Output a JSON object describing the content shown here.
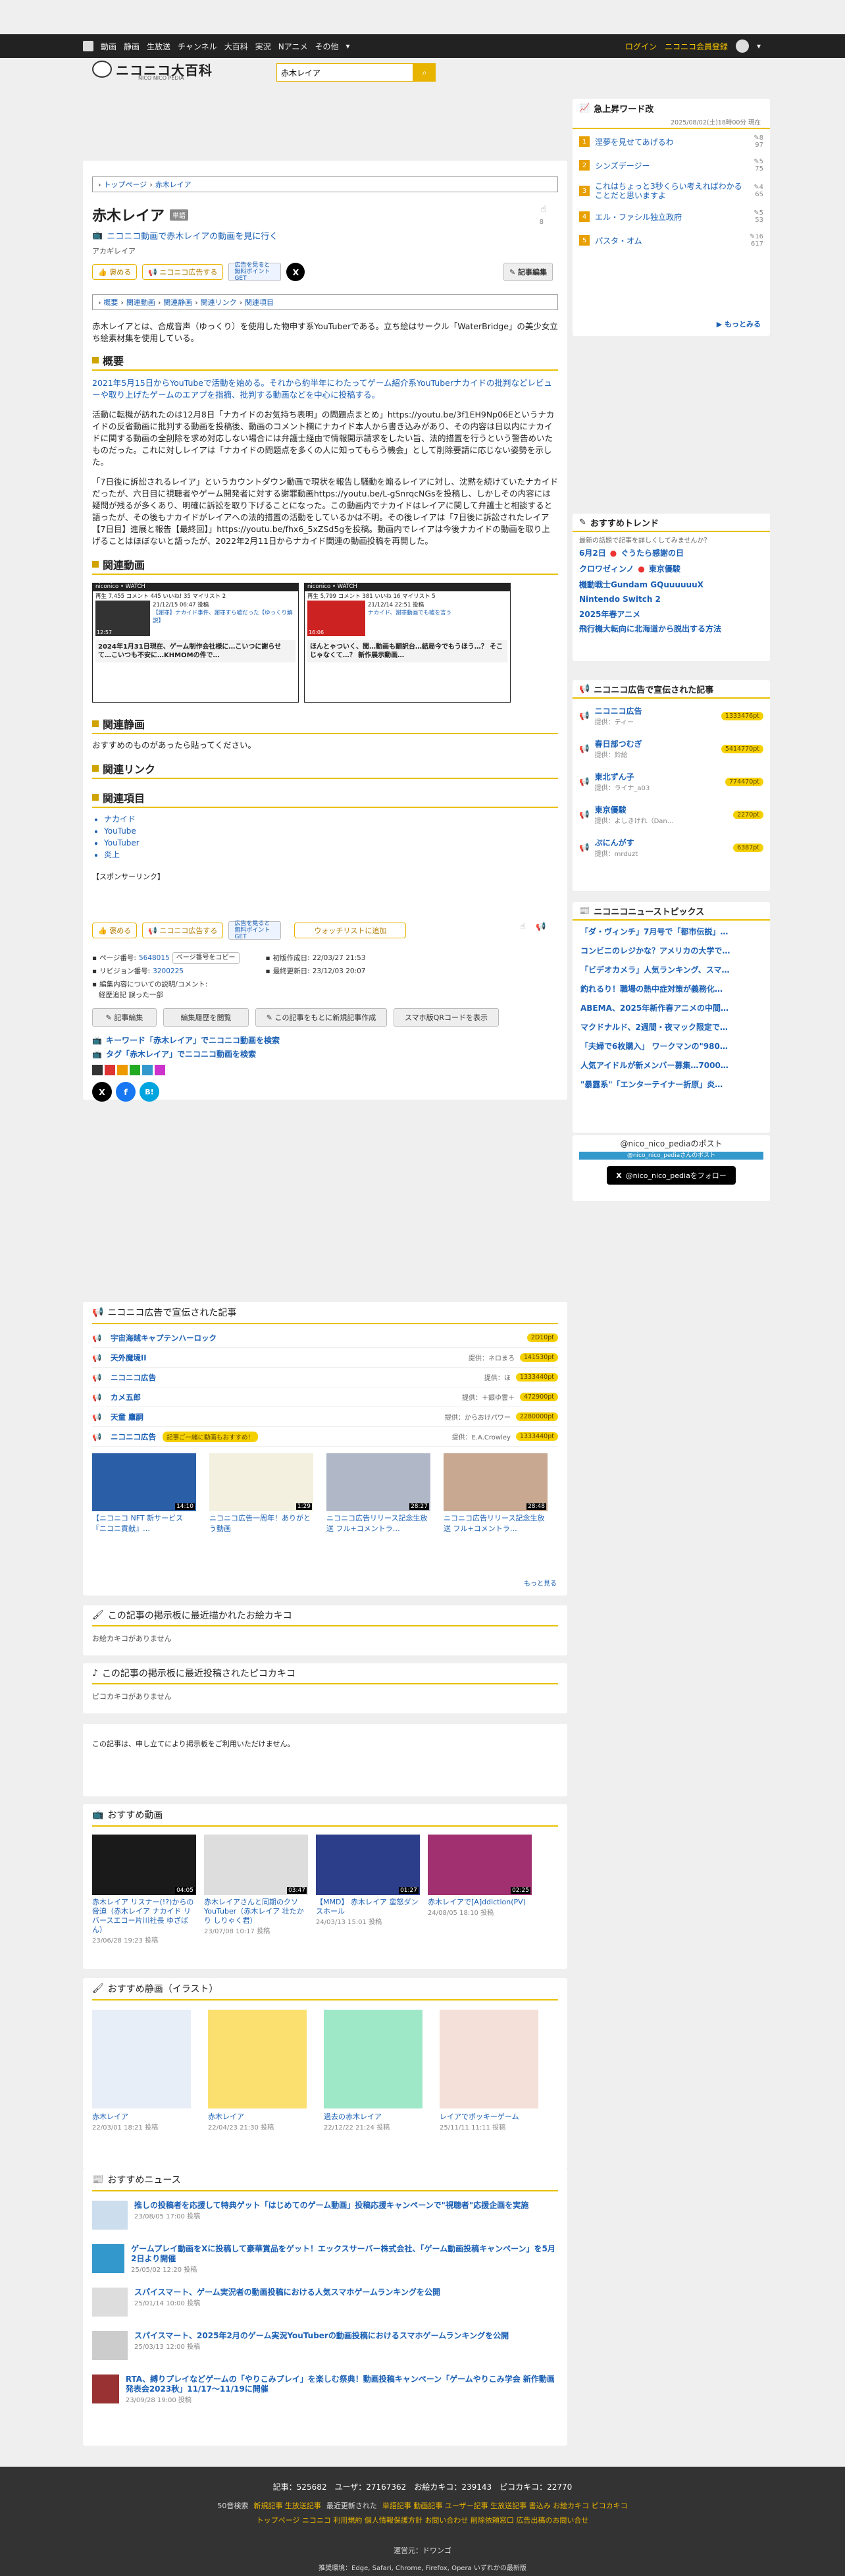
{
  "header": {
    "nav": [
      "動画",
      "静画",
      "生放送",
      "チャンネル",
      "大百科",
      "実況",
      "Nアニメ",
      "その他"
    ],
    "login": "ログイン",
    "register": "ニコニコ会員登録",
    "search_value": "赤木レイア",
    "logo_sub": "NICO NICO PEDIA"
  },
  "breadcrumb": [
    "トップページ",
    "赤木レイア"
  ],
  "article": {
    "title": "赤木レイア",
    "title_badge": "単語",
    "watch_link": "ニコニコ動画で赤木レイアの動画を見に行く",
    "reading": "アカギレイア",
    "like_count": "8",
    "ad_count": "0pt",
    "buttons": {
      "praise": "褒める",
      "ad": "ニコニコ広告する",
      "ad_note": "広告を見ると\n無料ポイントGET",
      "edit": "記事編集"
    },
    "toc": [
      "概要",
      "関連動画",
      "関連静画",
      "関連リンク",
      "関連項目"
    ],
    "intro": "赤木レイアとは、合成音声（ゆっくり）を使用した物申す系YouTuberである。立ち絵はサークル「WaterBridge」の美少女立ち絵素材集を使用している。",
    "overview_title": "概要",
    "overview_p1": "2021年5月15日からYouTubeで活動を始める。それから約半年にわたってゲーム紹介系YouTuberナカイドの批判などレビューや取り上げたゲームのエアプを指摘、批判する動画などを中心に投稿する。",
    "overview_p2": "活動に転機が訪れたのは12月8日「ナカイドのお気持ち表明」の問題点まとめ」https://youtu.be/3f1EH9Np06Eというナカイドの反省動画に批判する動画を投稿後、動画のコメント欄にナカイド本人から書き込みがあり、その内容は日以内にナカイドに関する動画の全削除を求め対応しない場合には弁護士経由で情報開示請求をしたい旨、法的措置を行うという警告めいたものだった。これに対しレイアは「ナカイドの問題点を多くの人に知ってもらう機会」として削除要請に応じない姿勢を示した。",
    "overview_p3": "「7日後に訴訟されるレイア」というカウントダウン動画で現状を報告し騒動を煽るレイアに対し、沈黙を続けていたナカイドだったが、六日目に視聴者やゲーム開発者に対する謝罪動画https://youtu.be/L-gSnrqcNGsを投稿し、しかしその内容には疑問が残るが多くあり、明確に訴訟を取り下げることになった。この動画内でナカイドはレイアに関して弁護士と相談すると語ったが、その後もナカイドがレイアへの法的措置の活動をしているかは不明。その後レイアは「7日後に訴訟されたレイア【7日目】進展と報告【最終回】」https://youtu.be/fhx6_5xZSd5gを投稿。動画内でレイアは今後ナカイドの動画を取り上げることはほぼないと語ったが、2022年2月11日からナカイド関連の動画投稿を再開した。",
    "related_video_title": "関連動画",
    "videos": [
      {
        "stats": "再生 7,455 コメント 445 いいね! 35 マイリスト 2",
        "date": "21/12/15 06:47 投稿",
        "title": "【謝罪】ナカイド事件、謝罪すら嘘だった【ゆっくり解説】",
        "time": "12:57",
        "caption": "2024年1月31日現在、ゲーム制作会社様に…こいつに謝らせて…こいつも不安に…KHMOMの件で…"
      },
      {
        "stats": "再生 5,799 コメント 381 いいね 16 マイリスト 5",
        "date": "21/12/14 22:51 投稿",
        "title": "ナカイド、謝罪動画でも嘘を言う",
        "time": "16:06",
        "caption": "ほんとゃついく、聞…動画も翻訳台…結局今でもうほう…？ そこじゃなくて…？ 新作展示動画…"
      }
    ],
    "related_stills_title": "関連静画",
    "no_stills": "おすすめのものがあったら貼ってください。",
    "related_links_title": "関連リンク",
    "related_items_title": "関連項目",
    "items": [
      "ナカイド",
      "YouTube",
      "YouTuber",
      "炎上"
    ],
    "sponsor": "【スポンサーリンク】",
    "watchlist": "ウォッチリストに追加",
    "meta": {
      "page_no_label": "ページ番号:",
      "page_no": "5648015",
      "copy": "ページ番号をコピー",
      "rev_label": "リビジョン番号:",
      "rev": "3200225",
      "created_label": "初版作成日:",
      "created": "22/03/27 21:53",
      "updated_label": "最終更新日:",
      "updated": "23/12/03 20:07",
      "edit_comment": "編集内容についての説明/コメント:",
      "edit_comment2": "経歴追記 誤った一部"
    },
    "actions": [
      "記事編集",
      "編集履歴を閲覧",
      "この記事をもとに新規記事作成",
      "スマホ版QRコードを表示"
    ],
    "search_kw": "キーワード「赤木レイア」でニコニコ動画を検索",
    "search_tag": "タグ「赤木レイア」でニコニコ動画を検索"
  },
  "ad_section": {
    "title": "ニコニコ広告で宣伝された記事",
    "rows": [
      {
        "name": "宇宙海賊キャプテンハーロック",
        "who": "",
        "amount": "2D10pt"
      },
      {
        "name": "天外魔境II",
        "who": "提供：ネロまろ",
        "amount": "141530pt"
      },
      {
        "name": "ニコニコ広告",
        "who": "提供：ほ",
        "amount": "1333440pt"
      },
      {
        "name": "カメ五郎",
        "who": "提供：＋銀ゆ雲＋",
        "amount": "472900pt"
      },
      {
        "name": "天童 鷹嗣",
        "who": "提供：からおけパワー",
        "amount": "2280000pt"
      },
      {
        "name": "ニコニコ広告",
        "who": "提供：E.A.Crowley",
        "amount": "1333440pt"
      }
    ],
    "ad_notice": "記事ご一緒に動画もおすすめ！",
    "thumbs": [
      {
        "title": "【ニコニコ NFT 新サービス『ニコニ貢献』…",
        "time": "14:10"
      },
      {
        "title": "ニコニコ広告一周年！ありがとう動画",
        "time": "1:29"
      },
      {
        "title": "ニコニコ広告リリース記念生放送 フル+コメントラ…",
        "time": "28:27"
      },
      {
        "title": "ニコニコ広告リリース記念生放送 フル+コメントラ…",
        "time": "28:48"
      }
    ],
    "more": "もっと見る"
  },
  "board_pic": {
    "title": "この記事の掲示板に最近描かれたお絵カキコ",
    "empty": "お絵カキコがありません"
  },
  "board_pico": {
    "title": "この記事の掲示板に最近投稿されたピコカキコ",
    "empty": "ピコカキコがありません"
  },
  "board_notice": "この記事は、申し立てにより掲示板をご利用いただけません。",
  "rec_videos": {
    "title": "おすすめ動画",
    "items": [
      {
        "title": "赤木レイア リスナー(!?)からの脅迫（赤木レイア ナカイド リバースエコー片川社長 ゆざばん）",
        "date": "23/06/28 19:23 投稿",
        "time": "04:05"
      },
      {
        "title": "赤木レイアさんと同期のクソYouTuber（赤木レイア 壮たかり しりゃく君）",
        "date": "23/07/08 10:17 投稿",
        "time": "03:47"
      },
      {
        "title": "【MMD】 赤木レイア 蛮怒ダンスホール",
        "date": "24/03/13 15:01 投稿",
        "time": "01:27"
      },
      {
        "title": "赤木レイアで[A]ddiction(PV)",
        "date": "24/08/05 18:10 投稿",
        "time": "02:25"
      }
    ]
  },
  "rec_stills": {
    "title": "おすすめ静画（イラスト）",
    "items": [
      {
        "title": "赤木レイア",
        "date": "22/03/01 18:21 投稿"
      },
      {
        "title": "赤木レイア",
        "date": "22/04/23 21:30 投稿"
      },
      {
        "title": "過去の赤木レイア",
        "date": "22/12/22 21:24 投稿"
      },
      {
        "title": "レイアでボッキーゲーム",
        "date": "25/11/11 11:11 投稿"
      }
    ]
  },
  "rec_news": {
    "title": "おすすめニュース",
    "items": [
      {
        "title": "推しの投稿者を応援して特典ゲット「はじめてのゲーム動画」投稿応援キャンペーンで\"視聴者\"応援企画を実施",
        "date": "23/08/05 17:00 投稿"
      },
      {
        "title": "ゲームプレイ動画をXに投稿して豪華賞品をゲット！エックスサーバー株式会社、「ゲーム動画投稿キャンペーン」を5月2日より開催",
        "date": "25/05/02 12:20 投稿"
      },
      {
        "title": "スパイスマート、ゲーム実況者の動画投稿における人気スマホゲームランキングを公開",
        "date": "25/01/14 10:00 投稿"
      },
      {
        "title": "スパイスマート、2025年2月のゲーム実況YouTuberの動画投稿におけるスマホゲームランキングを公開",
        "date": "25/03/13 12:00 投稿"
      },
      {
        "title": "RTA、縛りプレイなどゲームの「やりこみプレイ」を楽しむ祭典！動画投稿キャンペーン「ゲームやりこみ学会 新作動画発表会2023秋」11/17〜11/19に開催",
        "date": "23/09/28 19:00 投稿"
      }
    ]
  },
  "sidebar": {
    "rising_title": "急上昇ワード改",
    "rising_date": "2025/08/02(土)18時00分 現在",
    "rising": [
      {
        "rank": "1",
        "word": "涅夢を見せてあげるわ",
        "count": "8",
        "pts": "97"
      },
      {
        "rank": "2",
        "word": "シンズデージー",
        "count": "5",
        "pts": "75"
      },
      {
        "rank": "3",
        "word": "これはちょっと3秒くらい考えればわかることだと思いますよ",
        "count": "4",
        "pts": "65"
      },
      {
        "rank": "4",
        "word": "エル・ファシル独立政府",
        "count": "5",
        "pts": "53"
      },
      {
        "rank": "5",
        "word": "パスタ・オム",
        "count": "16",
        "pts": "617"
      }
    ],
    "rising_more": "もっとみる",
    "trend_title": "おすすめトレンド",
    "trend_sub": "最新の話題で記事を詳しくしてみませんか？",
    "trends": [
      [
        "6月2日",
        "ぐうたら感謝の日"
      ],
      [
        "クロワゼィンノ",
        "東京優駿"
      ],
      [
        "機動戦士Gundam GQuuuuuuX",
        ""
      ],
      [
        "Nintendo Switch 2",
        ""
      ],
      [
        "2025年春アニメ",
        ""
      ],
      [
        "飛行機大転向に北海道から脱出する方法",
        ""
      ]
    ],
    "ad_title": "ニコニコ広告で宣伝された記事",
    "ads": [
      {
        "name": "ニコニコ広告",
        "who": "提供：ティー",
        "amount": "1333476pt"
      },
      {
        "name": "春日部つむぎ",
        "who": "提供：鈴絵",
        "amount": "5414770pt"
      },
      {
        "name": "東北ずん子",
        "who": "提供：ライナ_a03",
        "amount": "774470pt"
      },
      {
        "name": "東京優駿",
        "who": "提供：よしきけれ（Dan...",
        "amount": "2270pt"
      },
      {
        "name": "ぷにんがす",
        "who": "提供：mrduzt",
        "amount": "6387pt"
      }
    ],
    "news_title": "ニコニコニューストピックス",
    "news": [
      "「ダ・ヴィンチ」7月号で「都市伝説」…",
      "コンビニのレジかな？アメリカの大学で…",
      "「ビデオカメラ」人気ランキング、スマ…",
      "釣れるり！職場の熱中症対策が義務化…",
      "ABEMA、2025年新作春アニメの中間…",
      "マクドナルド、2週間・夜マック限定で…",
      "「夫婦で6枚購入」 ワークマンの\"980…",
      "人気アイドルが新メンバー募集…7000…",
      "\"暴露系\"「エンターテイナー折原」炎…"
    ],
    "x_title": "@nico_nico_pediaのポスト",
    "x_sub": "@nico_nico_pediaさんのポスト",
    "x_follow": "@nico_nico_pediaをフォロー"
  },
  "footer": {
    "stats": "記事：525682　ユーザ：27167362　お絵カキコ：239143　ピコカキコ：22770",
    "line1_label": "50音検索",
    "line1": "新規記事  生放送記事",
    "line1b_label": "最近更新された",
    "line1b": "単語記事  動画記事  ユーザー記事  生放送記事  書込み  お絵カキコ  ピコカキコ",
    "line2": "トップページ  ニコニコ  利用規約  個人情報保護方針  お問い合わせ  削除依頼窓口  広告出稿のお問い合せ",
    "operator": "運営元：ドワンゴ",
    "env": "推奨環境：Edge, Safari, Chrome, Firefox, Opera いずれかの最新版"
  }
}
